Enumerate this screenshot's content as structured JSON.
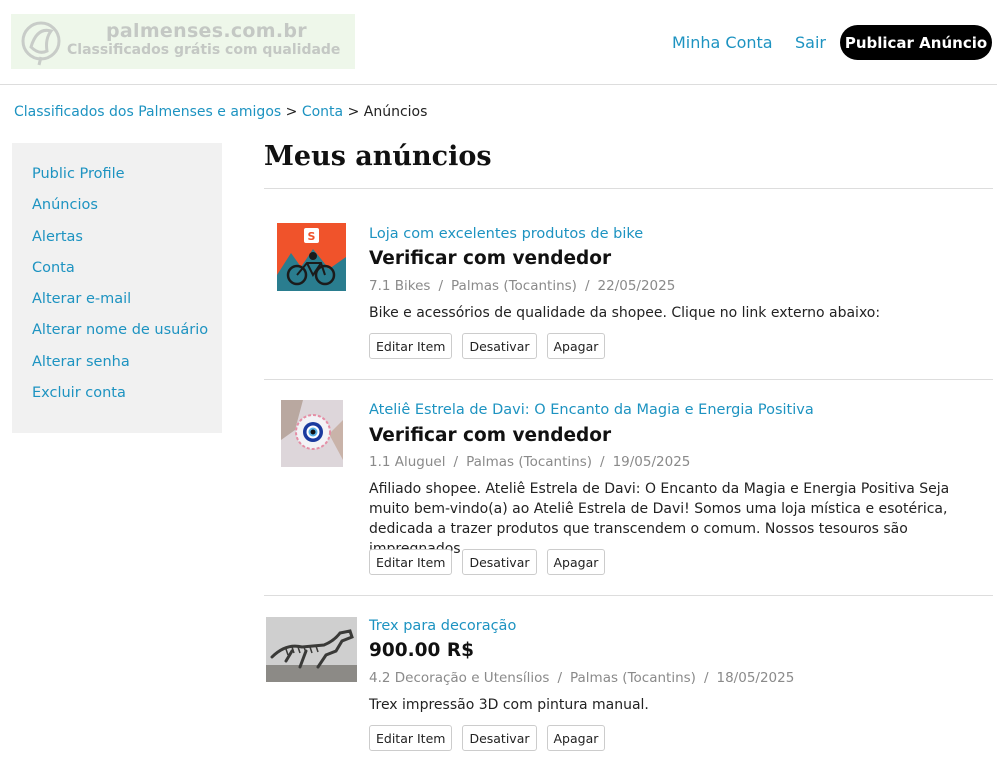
{
  "header": {
    "logo_title": "palmenses.com.br",
    "logo_subtitle": "Classificados grátis com qualidade",
    "nav_account": "Minha Conta",
    "nav_exit": "Sair",
    "publish_button": "Publicar Anúncio"
  },
  "breadcrumb": {
    "home": "Classificados dos Palmenses e amigos",
    "sep1": " > ",
    "account": "Conta",
    "sep2": " > ",
    "current": "Anúncios"
  },
  "sidebar": {
    "items": [
      {
        "label": "Public Profile"
      },
      {
        "label": "Anúncios"
      },
      {
        "label": "Alertas"
      },
      {
        "label": "Conta"
      },
      {
        "label": "Alterar e-mail"
      },
      {
        "label": "Alterar nome de usuário"
      },
      {
        "label": "Alterar senha"
      },
      {
        "label": "Excluir conta"
      }
    ]
  },
  "main": {
    "title": "Meus anúncios",
    "listings": [
      {
        "title": "Loja com excelentes produtos de bike",
        "price": "Verificar com vendedor",
        "category": "7.1 Bikes",
        "location": "Palmas (Tocantins)",
        "date": "22/05/2025",
        "separator": "/",
        "description": "Bike e acessórios de qualidade da shopee. Clique no link externo abaixo:"
      },
      {
        "title": "Ateliê Estrela de Davi: O Encanto da Magia e Energia Positiva",
        "price": "Verificar com vendedor",
        "category": "1.1 Aluguel",
        "location": "Palmas (Tocantins)",
        "date": "19/05/2025",
        "separator": "/",
        "description": "Afiliado shopee. Ateliê Estrela de Davi: O Encanto da Magia e Energia Positiva Seja muito bem-vindo(a) ao Ateliê Estrela de Davi! Somos uma loja mística e esotérica, dedicada a trazer produtos que transcendem o comum. Nossos tesouros são impregnados ..."
      },
      {
        "title": "Trex para decoração",
        "price": "900.00 R$",
        "category": "4.2 Decoração e Utensílios",
        "location": "Palmas (Tocantins)",
        "date": "18/05/2025",
        "separator": "/",
        "description": "Trex impressão 3D com pintura manual."
      }
    ],
    "buttons": {
      "edit": "Editar Item",
      "deactivate": "Desativar",
      "delete": "Apagar"
    }
  },
  "colors": {
    "link": "#1d93c1",
    "publish_bg": "#000000",
    "logo_bg": "#eef7ea",
    "sidebar_bg": "#f1f1f1"
  }
}
